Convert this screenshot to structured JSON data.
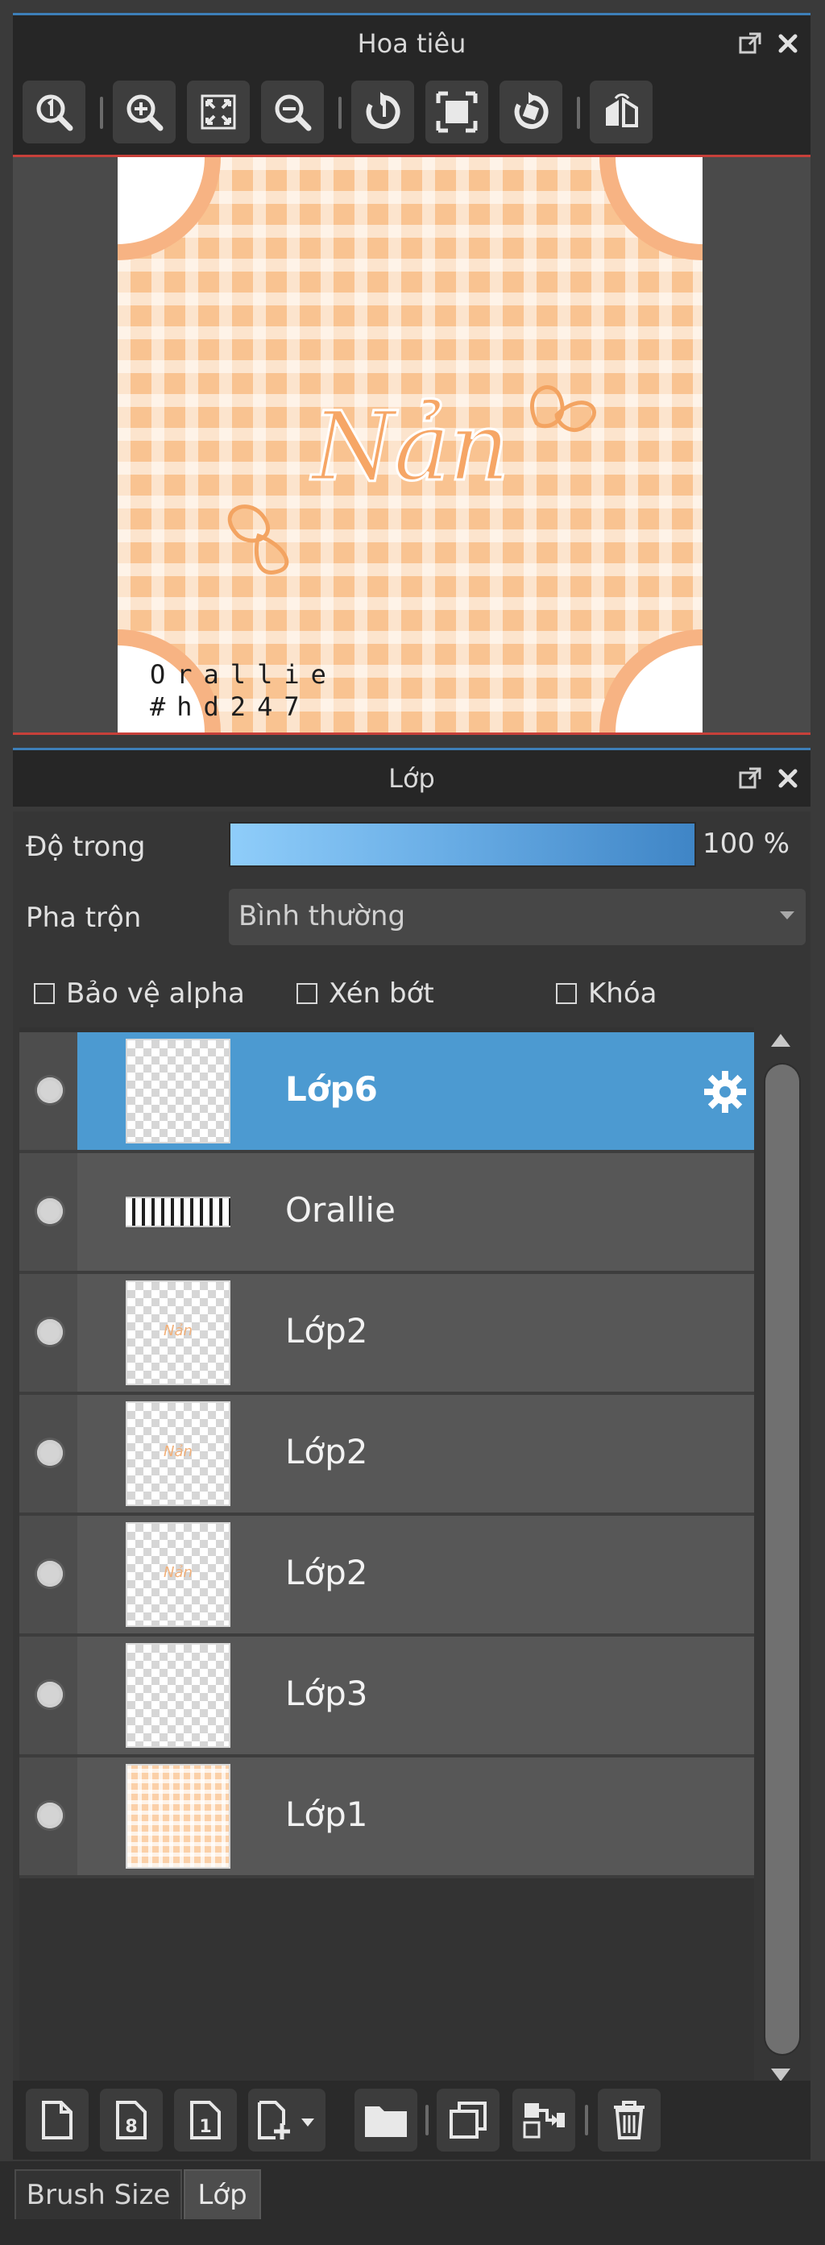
{
  "navigator": {
    "title": "Hoa tiêu",
    "toolbar_icons": [
      "zoom-actual-icon",
      "zoom-in-icon",
      "fit-screen-icon",
      "zoom-out-icon",
      "rotate-reset-icon",
      "fit-frame-icon",
      "rotate-icon",
      "flip-horizontal-icon"
    ],
    "canvas_text": "Nản",
    "credit_line1": "Orallie",
    "credit_line2": "#hd247"
  },
  "layer_panel": {
    "title": "Lớp",
    "opacity_label": "Độ trong",
    "opacity_value": "100 %",
    "opacity_percent": 100,
    "blend_label": "Pha trộn",
    "blend_value": "Bình thường",
    "checkboxes": [
      {
        "label": "Bảo vệ alpha",
        "checked": false
      },
      {
        "label": "Xén bớt",
        "checked": false
      },
      {
        "label": "Khóa",
        "checked": false
      }
    ],
    "layers": [
      {
        "name": "Lớp6",
        "selected": true,
        "visible": true
      },
      {
        "name": "Orallie",
        "selected": false,
        "visible": true
      },
      {
        "name": "Lớp2",
        "selected": false,
        "visible": true
      },
      {
        "name": "Lớp2",
        "selected": false,
        "visible": true
      },
      {
        "name": "Lớp2",
        "selected": false,
        "visible": true
      },
      {
        "name": "Lớp3",
        "selected": false,
        "visible": true
      },
      {
        "name": "Lớp1",
        "selected": false,
        "visible": true
      }
    ],
    "toolbar_icons": [
      "new-layer-icon",
      "new-8bit-layer-icon",
      "new-1bit-layer-icon",
      "add-layer-menu-icon",
      "folder-icon",
      "duplicate-icon",
      "merge-down-icon",
      "trash-icon"
    ]
  },
  "tabs": [
    {
      "label": "Brush Size",
      "active": false
    },
    {
      "label": "Lớp",
      "active": true
    }
  ],
  "colors": {
    "accent_blue": "#4c9ad1",
    "canvas_peach": "#f9c79a",
    "header_line": "#3d7fb8",
    "frame_red": "#c7403a"
  }
}
